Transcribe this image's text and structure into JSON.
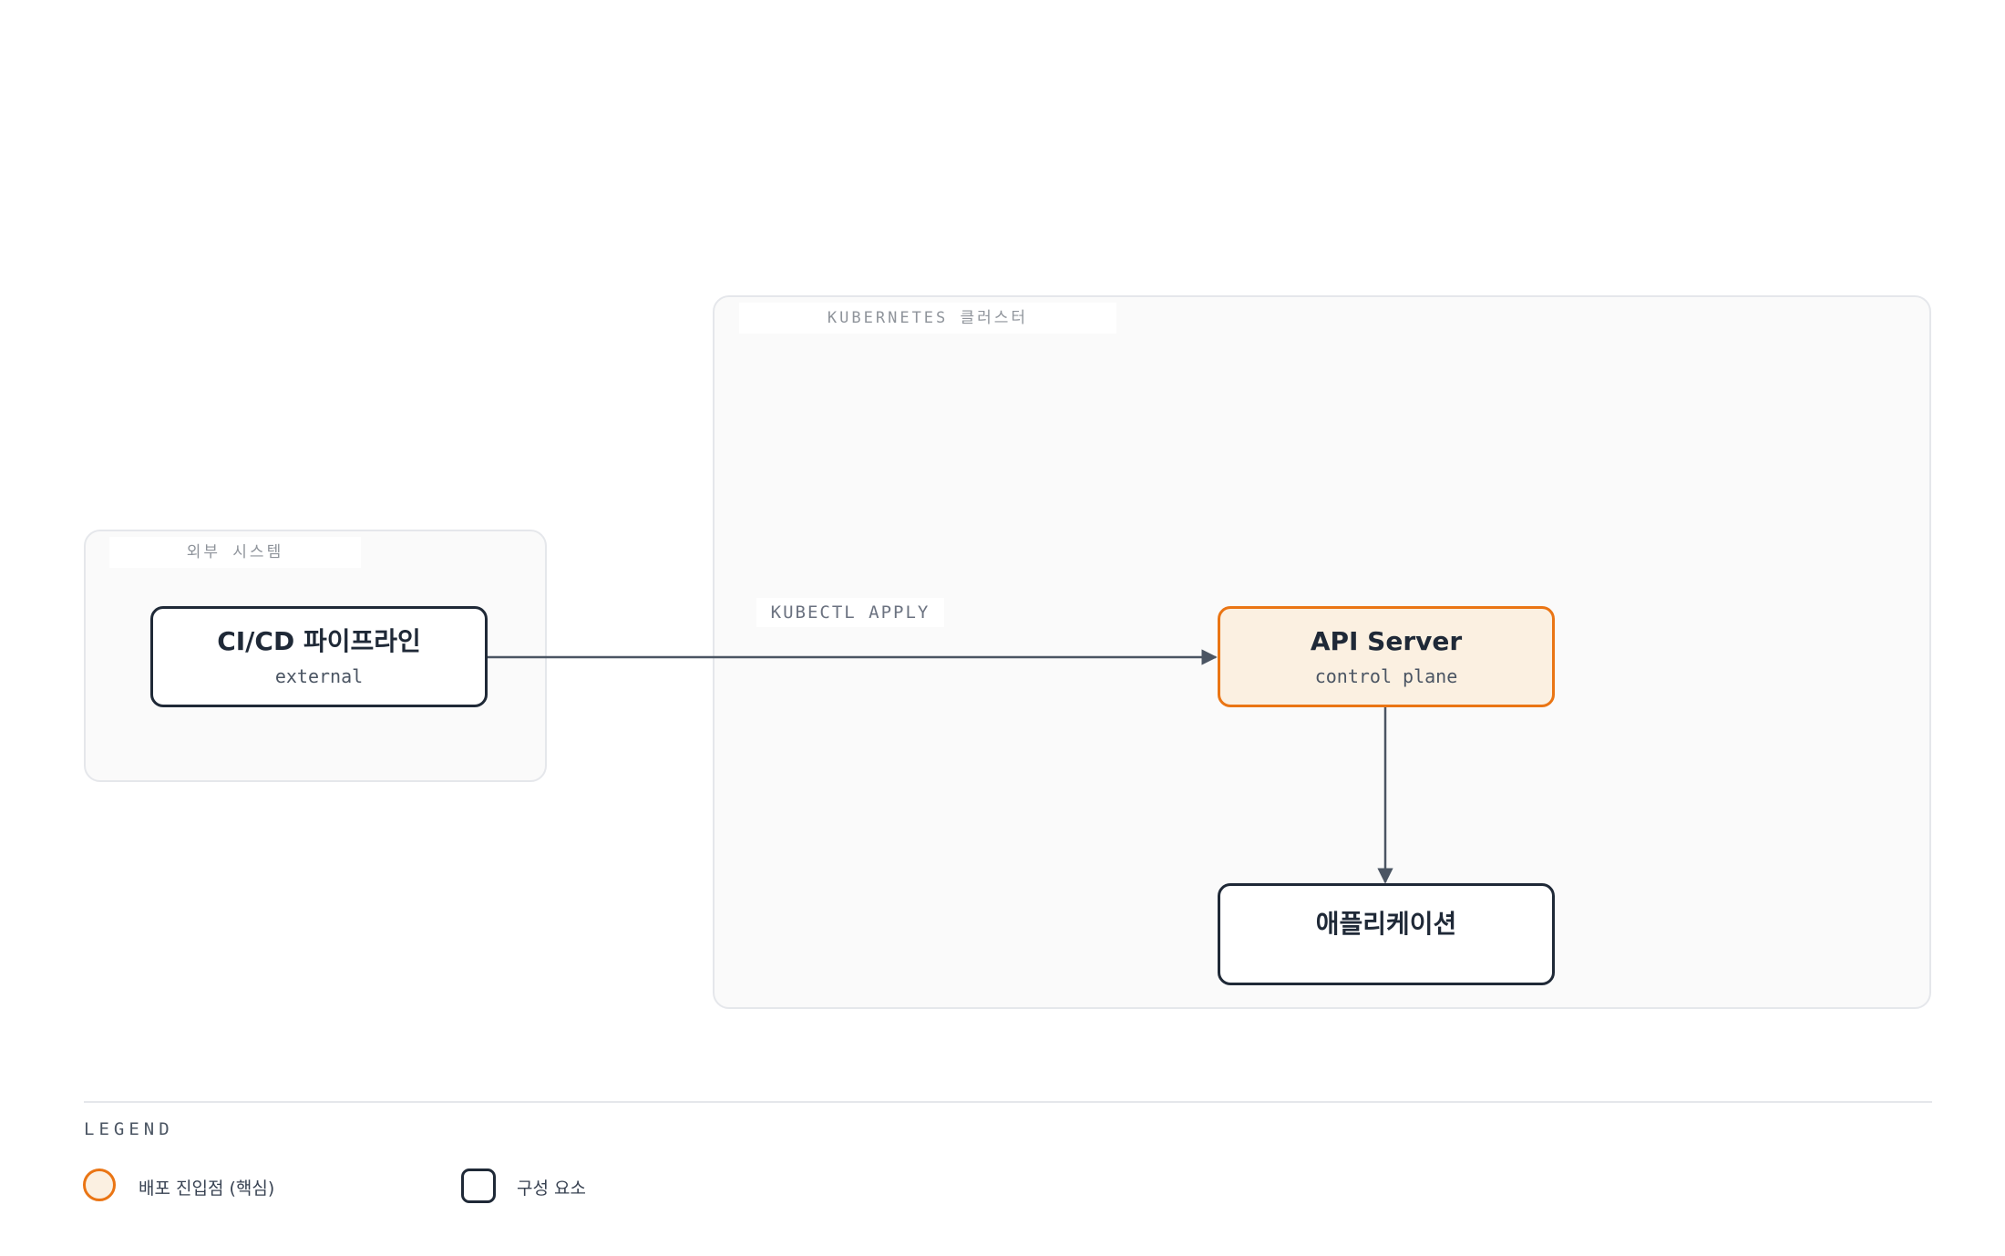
{
  "groups": {
    "external": {
      "label": "외부 시스템"
    },
    "cluster": {
      "label": "KUBERNETES 클러스터"
    }
  },
  "nodes": {
    "cicd": {
      "title": "CI/CD 파이프라인",
      "subtitle": "external"
    },
    "api": {
      "title": "API Server",
      "subtitle": "control plane"
    },
    "app": {
      "title": "애플리케이션"
    }
  },
  "edges": [
    {
      "from": "cicd",
      "to": "api",
      "label": "KUBECTL APPLY"
    },
    {
      "from": "api",
      "to": "app",
      "label": ""
    }
  ],
  "legend": {
    "title": "LEGEND",
    "items": [
      {
        "label": "배포 진입점 (핵심)",
        "style": "core"
      },
      {
        "label": "구성 요소",
        "style": "component"
      }
    ]
  },
  "colors": {
    "accent": "#ea7514",
    "accent_fill": "#fbf0e1",
    "node_border": "#1f2937",
    "edge": "#4b5563"
  }
}
